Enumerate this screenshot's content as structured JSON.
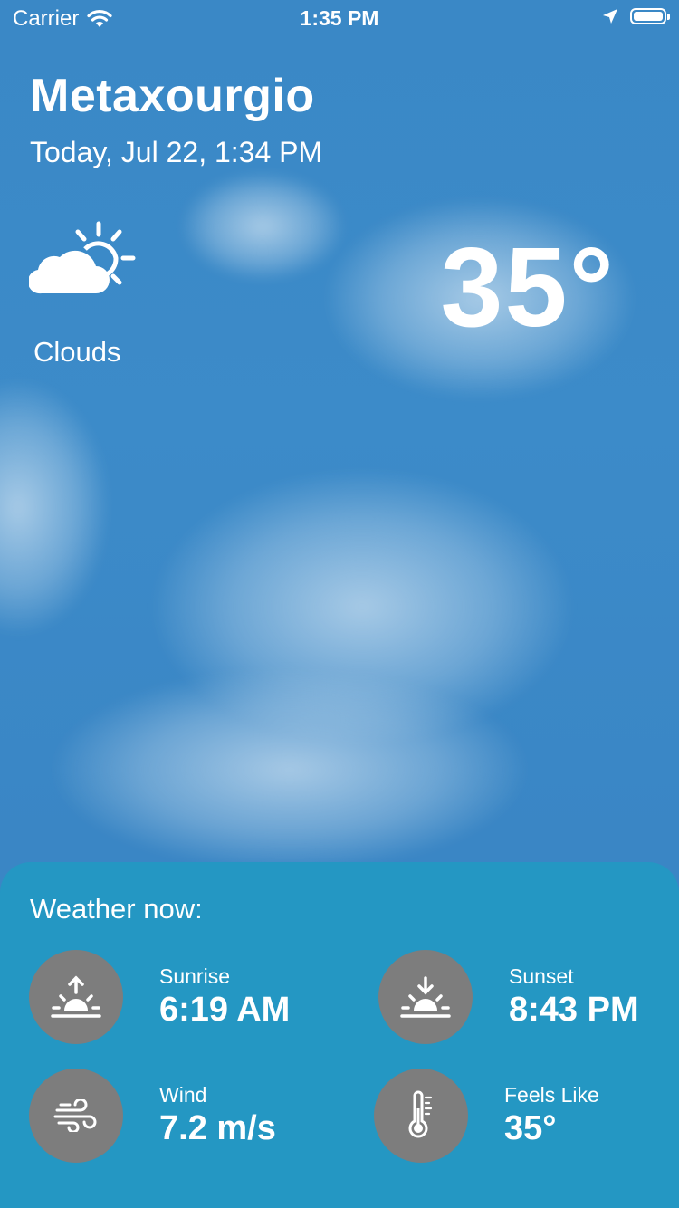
{
  "status_bar": {
    "carrier": "Carrier",
    "time": "1:35 PM"
  },
  "location": {
    "city": "Metaxourgio",
    "date_time": "Today, Jul 22, 1:34 PM"
  },
  "current": {
    "condition": "Clouds",
    "condition_icon": "partly-cloudy-icon",
    "temperature": "35°"
  },
  "details": {
    "title": "Weather now:",
    "items": [
      {
        "label": "Sunrise",
        "value": "6:19 AM",
        "icon": "sunrise-icon"
      },
      {
        "label": "Sunset",
        "value": "8:43 PM",
        "icon": "sunset-icon"
      },
      {
        "label": "Wind",
        "value": "7.2 m/s",
        "icon": "wind-icon"
      },
      {
        "label": "Feels Like",
        "value": "35°",
        "icon": "thermometer-icon"
      }
    ]
  },
  "colors": {
    "sky": "#3a88c6",
    "panel": "#2497c3",
    "icon_circle": "#7d7d7d"
  }
}
